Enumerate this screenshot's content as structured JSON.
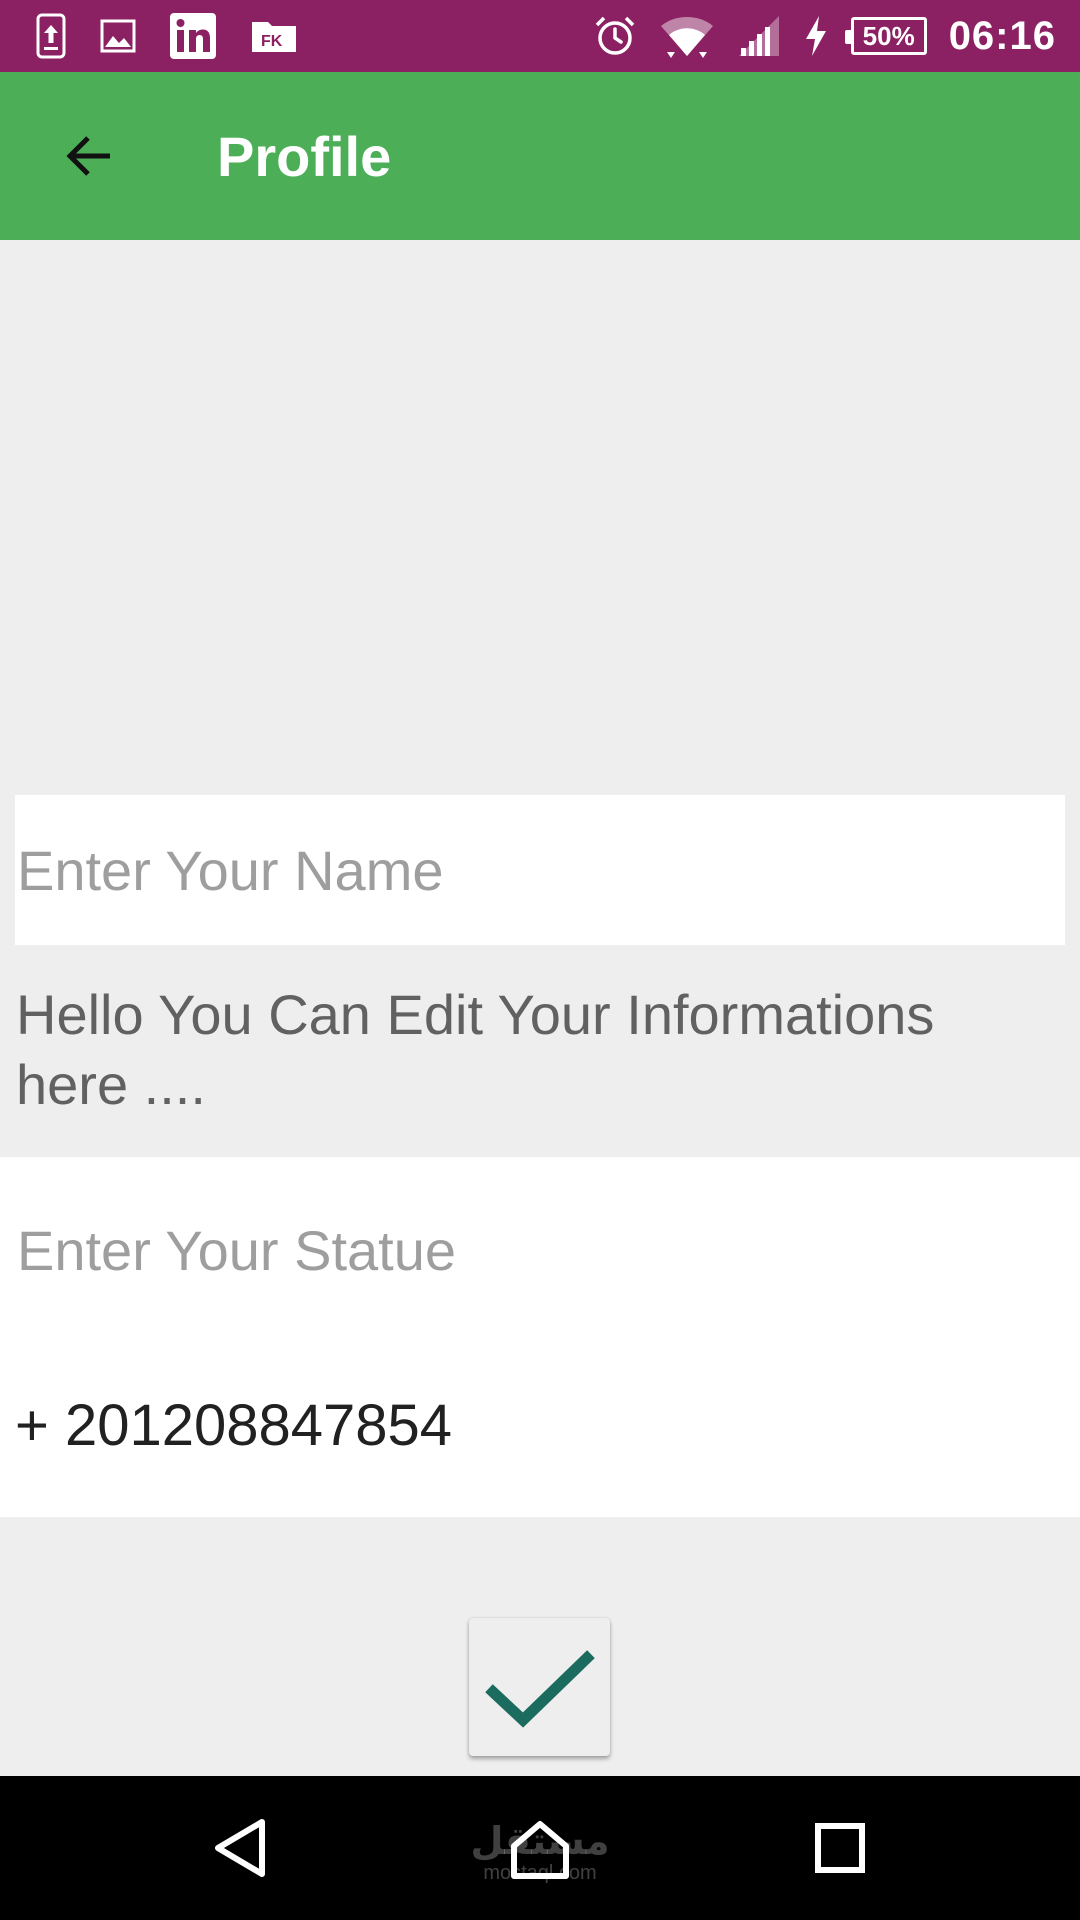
{
  "status_bar": {
    "left_icons": [
      "upload-icon",
      "gallery-icon",
      "linkedin-icon",
      "file-manager-icon"
    ],
    "right_icons": [
      "alarm-icon",
      "wifi-icon",
      "signal-icon",
      "charging-icon"
    ],
    "battery": "50%",
    "time": "06:16",
    "background_color": "#8B2163"
  },
  "app_bar": {
    "title": "Profile",
    "background_color": "#4CAF57"
  },
  "form": {
    "name_placeholder": "Enter Your Name",
    "info_text": "Hello You Can Edit Your Informations here ....",
    "statue_placeholder": "Enter Your Statue",
    "phone": "+ 201208847854"
  },
  "confirm_button": {
    "icon": "check-icon",
    "icon_color": "#1B6B5E"
  },
  "nav_bar": {
    "buttons": [
      "back-icon",
      "home-icon",
      "recents-icon"
    ],
    "watermark_top": "مستقل",
    "watermark_bottom": "mostaql.com"
  }
}
